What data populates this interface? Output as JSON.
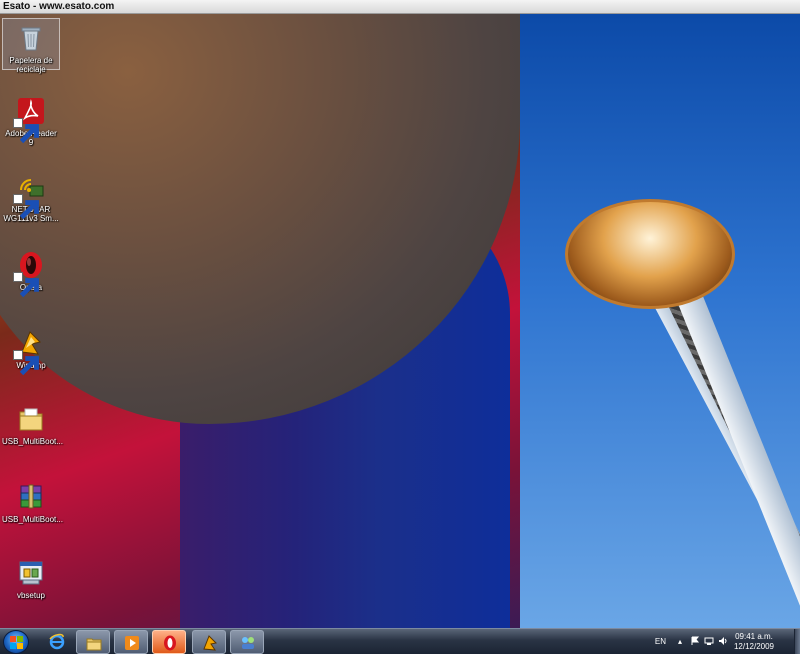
{
  "window": {
    "title": "Esato - www.esato.com"
  },
  "desktop_icons": [
    {
      "label": "Papelera de reciclaje",
      "icon": "recycle-bin-icon",
      "selected": true
    },
    {
      "label": "Adobe Reader 9",
      "icon": "adobe-reader-icon"
    },
    {
      "label": "NETGEAR WG111v3 Sm...",
      "icon": "netgear-wifi-icon"
    },
    {
      "label": "Opera",
      "icon": "opera-icon"
    },
    {
      "label": "Winamp",
      "icon": "winamp-icon"
    },
    {
      "label": "USB_MultiBoot...",
      "icon": "folder-icon"
    },
    {
      "label": "USB_MultiBoot...",
      "icon": "winrar-archive-icon"
    },
    {
      "label": "vbsetup",
      "icon": "installer-icon"
    }
  ],
  "taskbar": {
    "pinned": [
      "internet-explorer-icon",
      "windows-explorer-icon",
      "media-player-icon",
      "opera-icon",
      "winamp-icon",
      "network-icon"
    ],
    "tray": {
      "language": "EN",
      "time": "09:41 a.m.",
      "date": "12/12/2009"
    }
  },
  "colors": {
    "taskbar": "#2a3445",
    "accent": "#1c65c4",
    "opera_red": "#d8161f"
  }
}
